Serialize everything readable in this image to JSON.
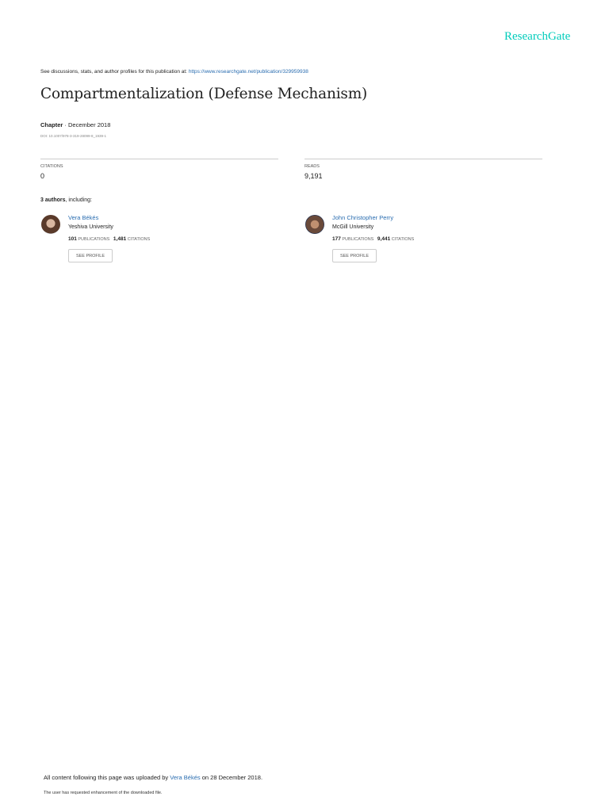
{
  "brand": "ResearchGate",
  "header": {
    "see_text": "See discussions, stats, and author profiles for this publication at:",
    "url": "https://www.researchgate.net/publication/329959938"
  },
  "title": "Compartmentalization (Defense Mechanism)",
  "meta": {
    "type": "Chapter",
    "date": " · December 2018",
    "doi": "DOI: 10.1007/978-3-319-28099-8_1939-1"
  },
  "stats": {
    "citations_label": "CITATIONS",
    "citations": "0",
    "reads_label": "READS",
    "reads": "9,191"
  },
  "authors_heading": {
    "count": "3 authors",
    "suffix": ", including:"
  },
  "authors": [
    {
      "name": "Vera Békés",
      "institution": "Yeshiva University",
      "publications": "101",
      "publications_label": "PUBLICATIONS",
      "citations": "1,481",
      "citations_label": "CITATIONS",
      "button": "SEE PROFILE"
    },
    {
      "name": "John Christopher Perry",
      "institution": "McGill University",
      "publications": "177",
      "publications_label": "PUBLICATIONS",
      "citations": "9,441",
      "citations_label": "CITATIONS",
      "button": "SEE PROFILE"
    }
  ],
  "footer": {
    "prefix": "All content following this page was uploaded by",
    "uploader": "Vera Békés",
    "suffix": "on 28 December 2018.",
    "request": "The user has requested enhancement of the downloaded file."
  }
}
